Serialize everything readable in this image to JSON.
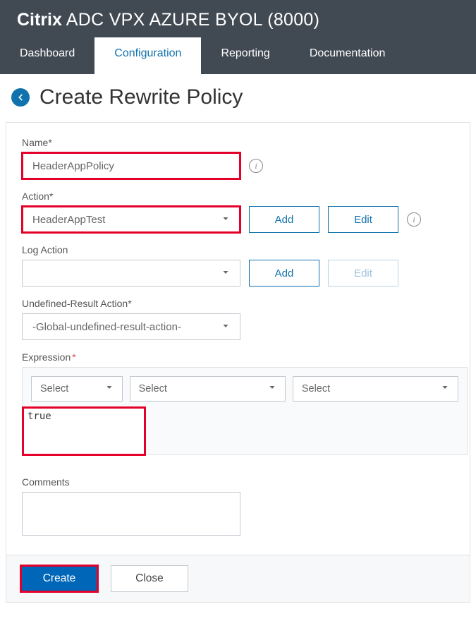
{
  "header": {
    "brand": "Citrix",
    "product": "ADC VPX AZURE BYOL (8000)"
  },
  "tabs": {
    "items": [
      "Dashboard",
      "Configuration",
      "Reporting",
      "Documentation"
    ],
    "active_index": 1
  },
  "page": {
    "title": "Create Rewrite Policy"
  },
  "form": {
    "name": {
      "label": "Name",
      "value": "HeaderAppPolicy"
    },
    "action": {
      "label": "Action",
      "value": "HeaderAppTest",
      "add": "Add",
      "edit": "Edit"
    },
    "log_action": {
      "label": "Log Action",
      "value": "",
      "add": "Add",
      "edit": "Edit"
    },
    "undef_action": {
      "label": "Undefined-Result Action",
      "value": "-Global-undefined-result-action-"
    },
    "expression": {
      "label": "Expression",
      "select_placeholder": "Select",
      "value": "true"
    },
    "comments": {
      "label": "Comments",
      "value": ""
    }
  },
  "footer": {
    "create": "Create",
    "close": "Close"
  }
}
